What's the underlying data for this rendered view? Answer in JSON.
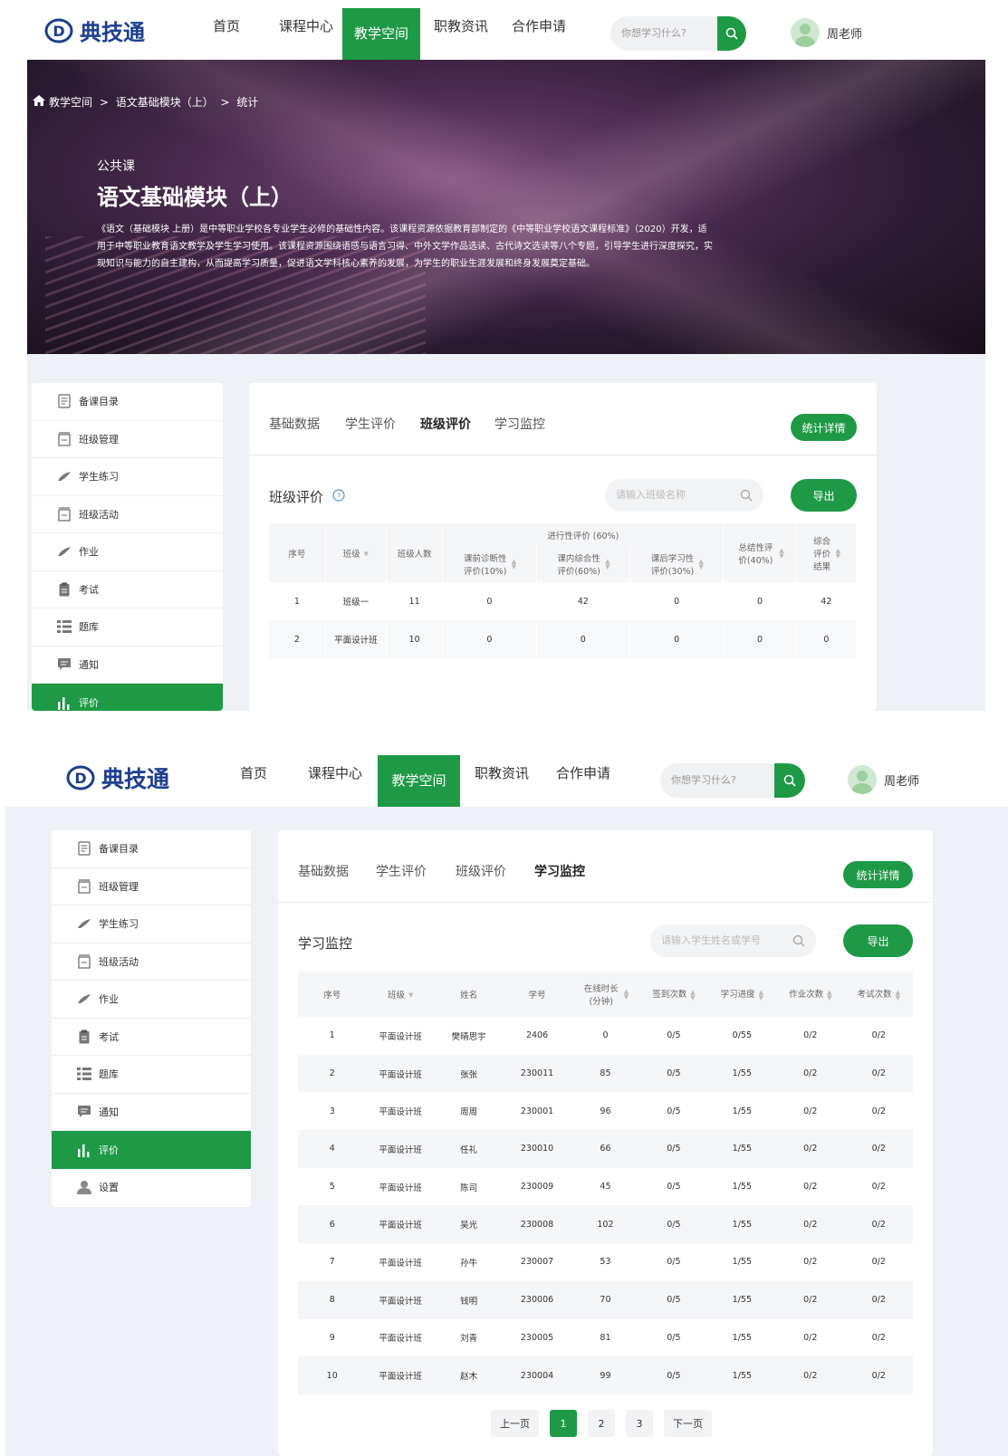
{
  "logo": {
    "text": "典技通"
  },
  "nav": {
    "items": [
      "首页",
      "课程中心",
      "教学空间",
      "职教资讯",
      "合作申请"
    ],
    "active": "教学空间",
    "search_placeholder": "你想学习什么?",
    "user_name": "周老师"
  },
  "breadcrumb": [
    "教学空间",
    "语文基础模块（上）",
    "统计"
  ],
  "course": {
    "category": "公共课",
    "title": "语文基础模块（上）",
    "description": "《语文（基础模块 上册）是中等职业学校各专业学生必修的基础性内容。该课程资源依据教育部制定的《中等职业学校语文课程标准》（2020）开发，适用于中等职业教育语文教学及学生学习使用。该课程资源围绕语感与语言习得、中外文学作品选读、古代诗文选读等八个专题，引导学生进行深度探究，实现知识与能力的自主建构，从而提高学习质量，促进语文学科核心素养的发展，为学生的职业生涯发展和终身发展奠定基础。"
  },
  "sidebar": {
    "items": [
      "备课目录",
      "班级管理",
      "学生练习",
      "班级活动",
      "作业",
      "考试",
      "题库",
      "通知",
      "评价",
      "设置"
    ],
    "active": "评价"
  },
  "tabs": [
    "基础数据",
    "学生评价",
    "班级评价",
    "学习监控"
  ],
  "stats_button": "统计详情",
  "export_button": "导出",
  "class_eval": {
    "title": "班级评价",
    "search_placeholder": "请输入班级名称",
    "headers": {
      "index": "序号",
      "class": "班级",
      "count": "班级人数",
      "process_group": "进行性评价 (60%)",
      "pre": "课前诊断性评价(10%)",
      "in": "课内综合性评价(60%)",
      "after": "课后学习性评价(30%)",
      "summary": "总结性评价(40%)",
      "overall": "综合评价结果"
    },
    "rows": [
      [
        "1",
        "班级一",
        "11",
        "0",
        "42",
        "0",
        "0",
        "42"
      ],
      [
        "2",
        "平面设计班",
        "10",
        "0",
        "0",
        "0",
        "0",
        "0"
      ]
    ]
  },
  "monitor": {
    "title": "学习监控",
    "search_placeholder": "请输入学生姓名或学号",
    "headers": [
      "序号",
      "班级",
      "姓名",
      "学号",
      "在线时长(分钟)",
      "签到次数",
      "学习进度",
      "作业次数",
      "考试次数"
    ],
    "rows": [
      [
        "1",
        "平面设计班",
        "樊晴思宇",
        "2406",
        "0",
        "0/5",
        "0/55",
        "0/2",
        "0/2"
      ],
      [
        "2",
        "平面设计班",
        "张张",
        "230011",
        "85",
        "0/5",
        "1/55",
        "0/2",
        "0/2"
      ],
      [
        "3",
        "平面设计班",
        "周周",
        "230001",
        "96",
        "0/5",
        "1/55",
        "0/2",
        "0/2"
      ],
      [
        "4",
        "平面设计班",
        "任礼",
        "230010",
        "66",
        "0/5",
        "1/55",
        "0/2",
        "0/2"
      ],
      [
        "5",
        "平面设计班",
        "陈司",
        "230009",
        "45",
        "0/5",
        "1/55",
        "0/2",
        "0/2"
      ],
      [
        "6",
        "平面设计班",
        "吴光",
        "230008",
        "102",
        "0/5",
        "1/55",
        "0/2",
        "0/2"
      ],
      [
        "7",
        "平面设计班",
        "孙牛",
        "230007",
        "53",
        "0/5",
        "1/55",
        "0/2",
        "0/2"
      ],
      [
        "8",
        "平面设计班",
        "钱明",
        "230006",
        "70",
        "0/5",
        "1/55",
        "0/2",
        "0/2"
      ],
      [
        "9",
        "平面设计班",
        "刘青",
        "230005",
        "81",
        "0/5",
        "1/55",
        "0/2",
        "0/2"
      ],
      [
        "10",
        "平面设计班",
        "赵木",
        "230004",
        "99",
        "0/5",
        "1/55",
        "0/2",
        "0/2"
      ]
    ]
  },
  "pagination": {
    "prev": "上一页",
    "pages": [
      "1",
      "2",
      "3"
    ],
    "current": "1",
    "next": "下一页"
  },
  "colors": {
    "brand_green": "#1e9a46",
    "logo_blue": "#1d3f8f",
    "page_bg": "#eef1f5"
  }
}
